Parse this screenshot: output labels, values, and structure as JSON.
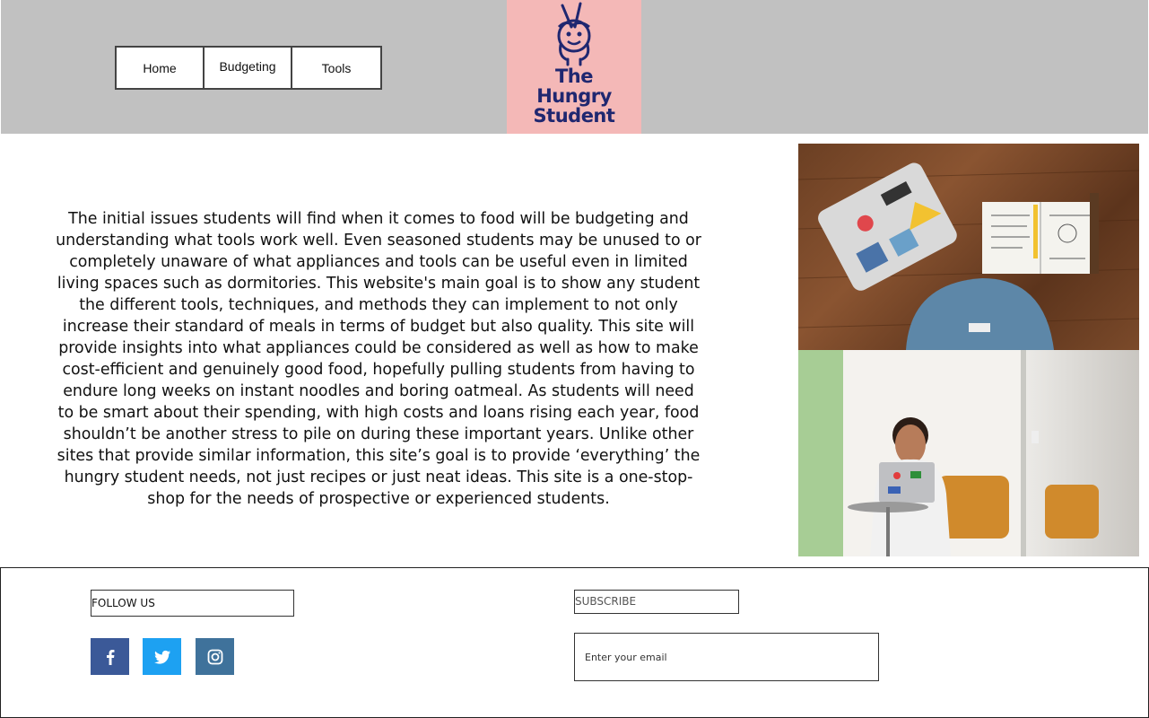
{
  "nav": {
    "items": [
      {
        "label": "Home"
      },
      {
        "label": "Budgeting"
      },
      {
        "label": "Tools"
      }
    ]
  },
  "logo": {
    "line1": "The",
    "line2": "Hungry",
    "line3": "Student",
    "bg_color": "#f4b8b7",
    "text_color": "#1f2770"
  },
  "intro": {
    "text": "The initial issues students will find when it comes to food will be budgeting and understanding what tools work well. Even seasoned students may be unused to or completely unaware of what appliances and tools can be useful even in limited living spaces such as dormitories. This website's main goal is to show any student the different tools, techniques, and methods they can implement to not only increase their standard of meals in terms of budget but also quality. This site will provide insights into what appliances could be considered as well as how to make cost-efficient and genuinely good food, hopefully pulling students from having to endure long weeks on instant noodles and boring oatmeal. As students will need to be smart about their spending, with high costs and loans rising each year, food shouldn’t be another stress to pile on during these important years. Unlike other sites that provide similar information, this site’s goal is to provide ‘everything’ the hungry student needs, not just recipes or just neat ideas. This site is a one-stop-shop for the needs of prospective or experienced students."
  },
  "footer": {
    "follow_label": "FOLLOW US",
    "subscribe_label": "SUBSCRIBE",
    "email_placeholder": "Enter your email",
    "social": [
      {
        "icon": "facebook-icon",
        "color": "#3b5998"
      },
      {
        "icon": "twitter-icon",
        "color": "#1da1f2"
      },
      {
        "icon": "instagram-icon",
        "color": "#3f729b"
      }
    ]
  },
  "colors": {
    "header_bg": "#c1c1c1"
  }
}
